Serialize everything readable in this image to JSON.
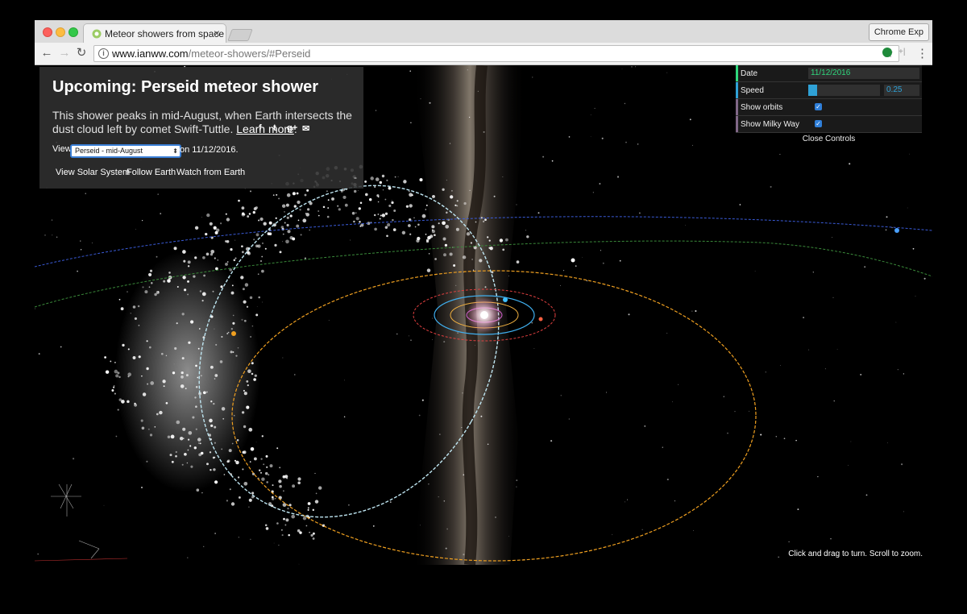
{
  "browser": {
    "tab_title": "Meteor showers from space",
    "url_domain": "www.ianww.com",
    "url_path": "/meteor-showers/#Perseid",
    "profile_label": "Chrome Exp",
    "back_icon": "←",
    "forward_icon": "→",
    "reload_icon": "↻",
    "star_icon": "☆",
    "menu_icon": "⋮",
    "close_icon": "×",
    "info_icon": "i",
    "ext2_label": "+|"
  },
  "info_panel": {
    "title": "Upcoming: Perseid meteor shower",
    "description": "This shower peaks in mid-August, when Earth intersects the dust cloud left by comet Swift-Tuttle.",
    "learn_more": "Learn more",
    "period": ".",
    "share": {
      "facebook": "f",
      "twitter": "t",
      "google": "g+",
      "email": "✉"
    },
    "view_label": "View",
    "view_selected": "Perseid - mid-August",
    "select_arrow": "⬍",
    "view_date": "on 11/12/2016.",
    "buttons": [
      "View Solar System",
      "Follow Earth",
      "Watch from Earth"
    ],
    "minimize": "-"
  },
  "controls": {
    "date_label": "Date",
    "date_value": "11/12/2016",
    "speed_label": "Speed",
    "speed_value": "0.25",
    "speed_fraction": 0.12,
    "show_orbits_label": "Show orbits",
    "show_orbits_checked": true,
    "show_milky_way_label": "Show Milky Way",
    "show_milky_way_checked": true,
    "check_mark": "✓",
    "close_label": "Close Controls"
  },
  "hint": "Click and drag to turn. Scroll to zoom.",
  "colors": {
    "accent_date": "#2fd87d",
    "accent_speed": "#2fa1d6",
    "checkbox": "#2f7fd9",
    "orbit_comet": "#bfe6f2",
    "orbit_yellow": "#f0a020",
    "orbit_blue": "#3a5bd8",
    "orbit_green": "#3a8a3a"
  }
}
